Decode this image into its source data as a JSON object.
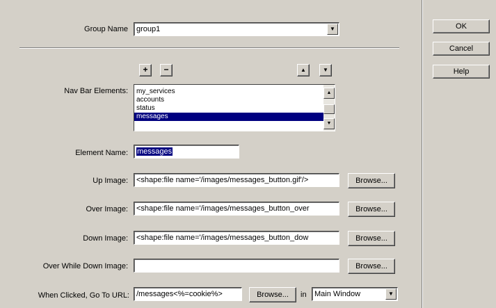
{
  "dialog": {
    "group_name": {
      "label": "Group Name",
      "value": "group1"
    },
    "buttons": {
      "ok": "OK",
      "cancel": "Cancel",
      "help": "Help"
    },
    "toolbar": {
      "add": "+",
      "remove": "−",
      "move_up": "▲",
      "move_down": "▼"
    },
    "nav_bar": {
      "label": "Nav Bar Elements:",
      "items": [
        "my_services",
        "accounts",
        "status",
        "messages"
      ],
      "selected_index": 3
    },
    "element_name": {
      "label": "Element Name:",
      "value": "messages"
    },
    "up_image": {
      "label": "Up Image:",
      "value": "<shape:file name='/images/messages_button.gif'/>",
      "browse": "Browse..."
    },
    "over_image": {
      "label": "Over Image:",
      "value": "<shape:file name='/images/messages_button_over",
      "browse": "Browse..."
    },
    "down_image": {
      "label": "Down Image:",
      "value": "<shape:file name='/images/messages_button_dow",
      "browse": "Browse..."
    },
    "over_while_down": {
      "label": "Over While Down Image:",
      "value": "",
      "browse": "Browse..."
    },
    "when_clicked": {
      "label": "When Clicked, Go To URL:",
      "value": "/messages<%=cookie%>",
      "browse": "Browse...",
      "in_label": "in",
      "target": "Main Window"
    }
  }
}
